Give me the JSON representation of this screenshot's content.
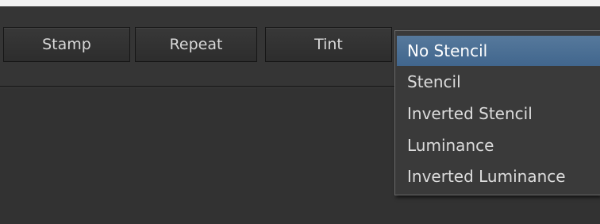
{
  "toolbar": {
    "buttons": [
      {
        "label": "Stamp"
      },
      {
        "label": "Repeat"
      },
      {
        "label": "Tint"
      }
    ]
  },
  "stencil_dropdown": {
    "selected": "No Stencil",
    "options": [
      {
        "label": "No Stencil"
      },
      {
        "label": "Stencil"
      },
      {
        "label": "Inverted Stencil"
      },
      {
        "label": "Luminance"
      },
      {
        "label": "Inverted Luminance"
      }
    ],
    "highlight_color": "#4b6f93"
  }
}
